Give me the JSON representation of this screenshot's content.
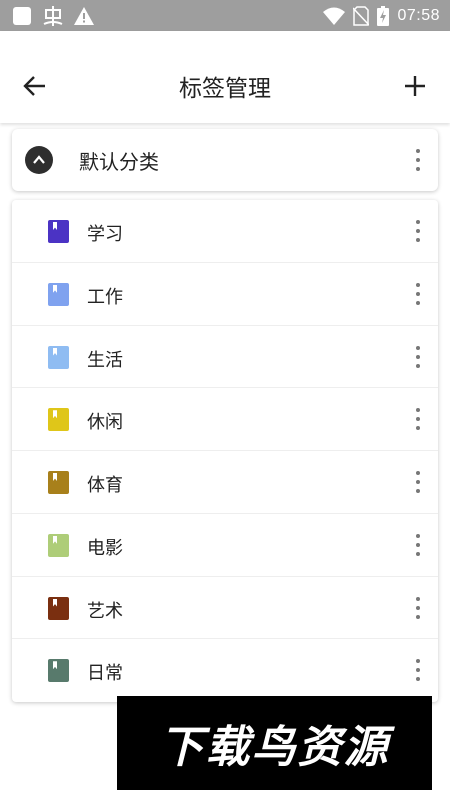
{
  "status_bar": {
    "time": "07:58",
    "left_icons": [
      "square-icon",
      "bug-icon",
      "warning-icon"
    ],
    "right_icons": [
      "wifi-icon",
      "no-sim-icon",
      "battery-charging-icon"
    ]
  },
  "app_bar": {
    "title": "标签管理",
    "back_icon": "arrow-left-icon",
    "add_icon": "plus-icon"
  },
  "category": {
    "name": "默认分类",
    "expanded": true,
    "toggle_icon": "chevron-up-icon"
  },
  "tags": [
    {
      "label": "学习",
      "color": "#4b33c4"
    },
    {
      "label": "工作",
      "color": "#7fa2ef"
    },
    {
      "label": "生活",
      "color": "#8fbcf2"
    },
    {
      "label": "休闲",
      "color": "#dfc619"
    },
    {
      "label": "体育",
      "color": "#a8801b"
    },
    {
      "label": "电影",
      "color": "#aecd78"
    },
    {
      "label": "艺术",
      "color": "#7a2f10"
    },
    {
      "label": "日常",
      "color": "#587a6c"
    }
  ],
  "watermark": {
    "text": "下载鸟资源"
  }
}
